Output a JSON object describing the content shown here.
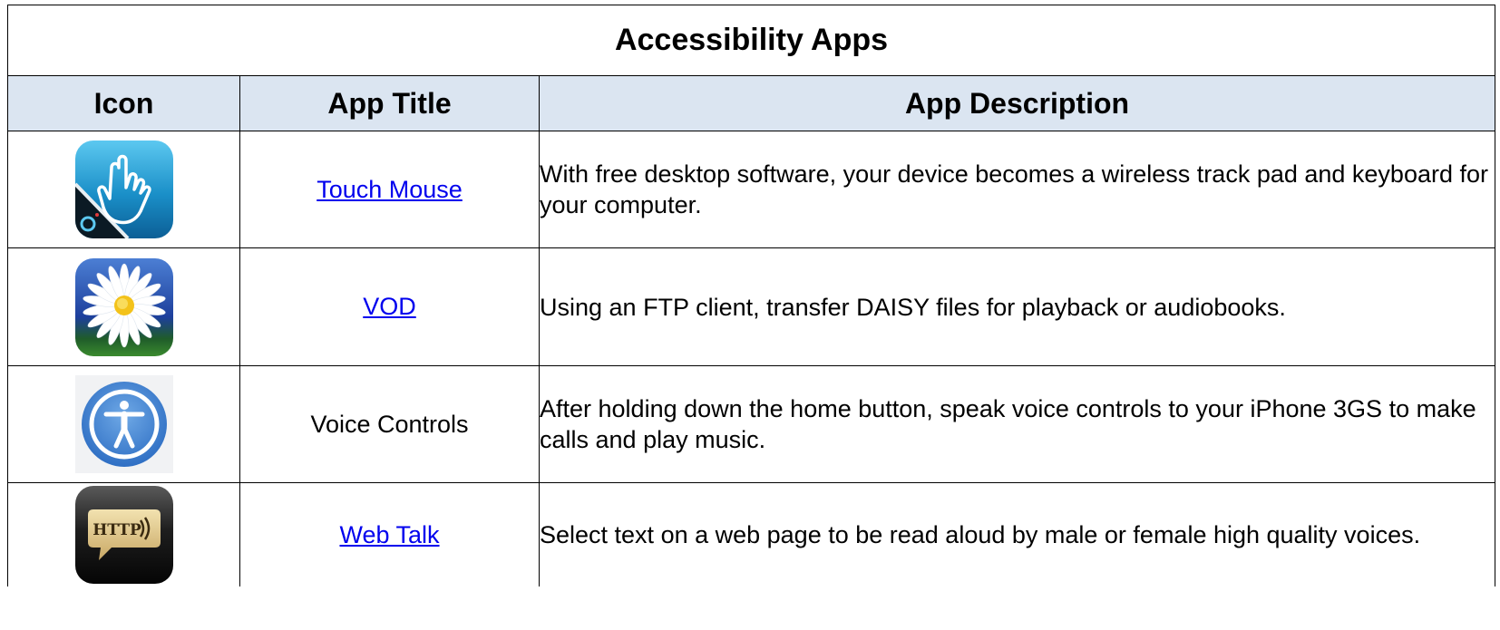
{
  "table": {
    "title": "Accessibility Apps",
    "header_bg": "#dbe5f1",
    "headers": {
      "icon": "Icon",
      "title": "App Title",
      "description": "App Description"
    },
    "rows": [
      {
        "icon": "touch-mouse-app-icon",
        "name": "Touch Mouse",
        "is_link": true,
        "description": "With free desktop software, your device becomes a wireless track pad and keyboard for your computer."
      },
      {
        "icon": "daisy-flower-app-icon",
        "name": "VOD",
        "is_link": true,
        "description": "Using an FTP client, transfer DAISY files for playback or audiobooks."
      },
      {
        "icon": "accessibility-person-app-icon",
        "name": "Voice Controls",
        "is_link": false,
        "description": "After holding down the home button, speak voice controls to your iPhone 3GS to make calls and play music."
      },
      {
        "icon": "http-speech-bubble-app-icon",
        "name": "Web Talk",
        "is_link": true,
        "description": "Select text on a web page to be read aloud by male or female high quality voices.",
        "icon_text": "HTTP"
      }
    ],
    "link_color": "#0000ee"
  }
}
